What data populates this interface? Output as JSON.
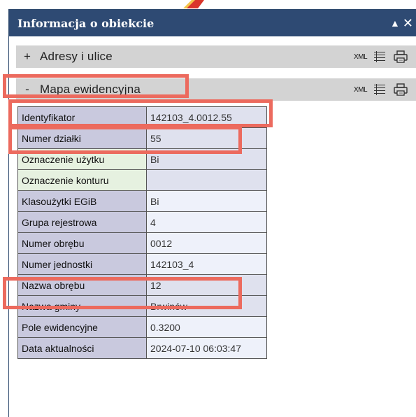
{
  "window": {
    "title": "Informacja o obiekcie"
  },
  "sections": [
    {
      "sign": "+",
      "label": "Adresy i ulice",
      "xml": "XML"
    },
    {
      "sign": "-",
      "label": "Mapa ewidencyjna",
      "xml": "XML"
    }
  ],
  "properties": [
    {
      "key": "Identyfikator",
      "value": "142103_4.0012.55"
    },
    {
      "key": "Numer działki",
      "value": "55"
    },
    {
      "key": "Oznaczenie użytku",
      "value": "Bi"
    },
    {
      "key": "Oznaczenie konturu",
      "value": ""
    },
    {
      "key": "Klasoużytki EGiB",
      "value": "Bi"
    },
    {
      "key": "Grupa rejestrowa",
      "value": "4"
    },
    {
      "key": "Numer obrębu",
      "value": "0012"
    },
    {
      "key": "Numer jednostki",
      "value": "142103_4"
    },
    {
      "key": "Nazwa obrębu",
      "value": "12"
    },
    {
      "key": "Nazwa gminy",
      "value": "Brwinów"
    },
    {
      "key": "Pole ewidencyjne",
      "value": "0.3200"
    },
    {
      "key": "Data aktualności",
      "value": "2024-07-10 06:03:47"
    }
  ],
  "icons": {
    "minimize": "triangle-up-icon",
    "close": "close-icon",
    "list": "list-icon",
    "print": "printer-icon"
  },
  "colors": {
    "titlebar": "#2e4a73",
    "section_bg": "#d3d3d3",
    "highlight": "#ec6a5e"
  }
}
